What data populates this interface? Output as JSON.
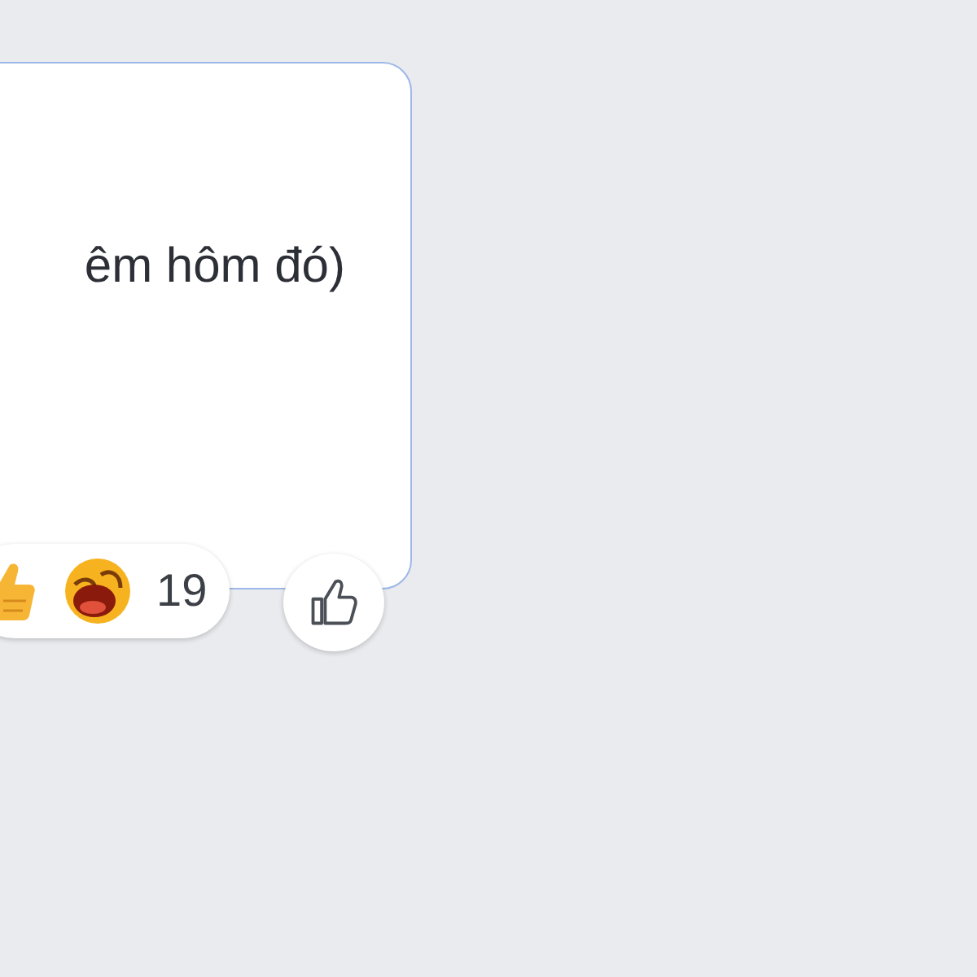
{
  "comment": {
    "text": "êm hôm đó)"
  },
  "reactions": {
    "types": [
      {
        "kind": "like"
      },
      {
        "kind": "haha"
      }
    ],
    "count": "19"
  },
  "like_button": {
    "liked": false
  }
}
